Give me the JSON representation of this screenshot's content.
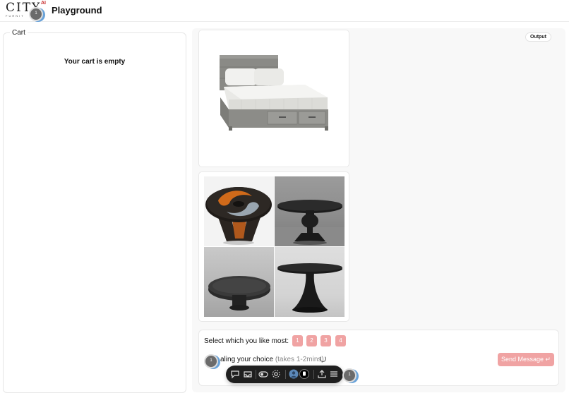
{
  "header": {
    "logo_text": "CITY",
    "logo_ai": "AI",
    "logo_sub": "FURNIT",
    "title": "Playground",
    "avatar_badge": "1"
  },
  "cart": {
    "legend": "Cart",
    "empty_message": "Your cart is empty"
  },
  "output": {
    "badge": "Output"
  },
  "selection": {
    "prompt": "Select which you like most:",
    "choices": [
      "1",
      "2",
      "3",
      "4"
    ]
  },
  "chat": {
    "status_text": "aling your choice",
    "status_hint": "(takes 1-2mins)",
    "send_label": "Send Message ↵",
    "avatar_badge": "1"
  },
  "toolbar": {
    "icons": [
      "comment-icon",
      "inbox-icon",
      "toggle-icon",
      "settings-icon",
      "avatar-icon",
      "dark-avatar-icon",
      "share-icon",
      "menu-icon"
    ],
    "avatar_badge": "1"
  },
  "colors": {
    "accent_disabled": "#f0a3a3",
    "toolbar_bg": "#1f1f1f"
  }
}
